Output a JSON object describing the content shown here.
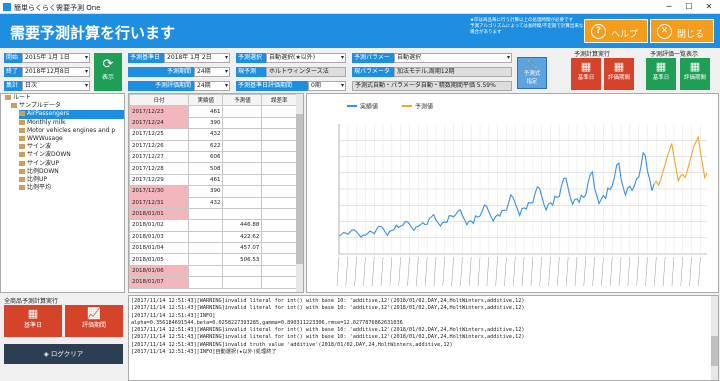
{
  "window": {
    "title": "簡単らくらく需要予測 One"
  },
  "banner": {
    "title": "需要予測計算を行います",
    "note_line1": "★印は商品毎に行う計算以上の処理時間が必要です",
    "note_line2": "予測アルゴリズムによっては長時間/不定期で計算出来ない場合があります",
    "help_label": "ヘルプ",
    "help_icon_glyph": "?",
    "close_label": "閉じる",
    "close_icon_glyph": "✕"
  },
  "params": {
    "start_label": "開始",
    "start_value": "2015年 1月 1日",
    "end_label": "終了",
    "end_value": "2018年12月8日",
    "agg_label": "集計",
    "agg_value": "日次",
    "show_label": "表示",
    "base_date_label": "予測基準日",
    "base_date_value": "2018年 1月 2日",
    "period_label": "予測期間",
    "period_value": "24期",
    "eval_period_label": "予測評価期間",
    "eval_period_value": "24期",
    "select_label": "予測選択",
    "select_value": "自動選択(★以外)",
    "current_label": "現予測",
    "current_value": "ホルトウィンタース法",
    "eval_base_label": "予測基準日評価期間",
    "eval_base_value": "0期",
    "param_label": "予測パラメータ",
    "param_value": "自動選択",
    "current_param_label": "現パラメータ",
    "current_param_value": "加法モデル,周期12期",
    "formula_value": "予測式自動・パラメータ自動・精数期間平価 5.59%",
    "formula_button_line1": "予測式",
    "formula_button_line2": "指定"
  },
  "exec": {
    "title": "予測計算実行",
    "base_btn": "基準日",
    "eval_btn": "評価期間"
  },
  "eval_view": {
    "title": "予測評価一覧表示",
    "base_btn": "基準日",
    "eval_btn": "評価期間"
  },
  "tree": {
    "root": "ルート",
    "group": "サンプルデータ",
    "items": [
      "AirPassengers",
      "Monthly milk",
      "Motor vehicles engines and p",
      "WWWusage",
      "サイン波",
      "サイン波DOWN",
      "サイン波UP",
      "比例DOWN",
      "比例UP",
      "比例平均"
    ]
  },
  "table": {
    "headers": [
      "日付",
      "実績値",
      "予測値",
      "誤差率"
    ],
    "rows": [
      {
        "date": "2017/12/23",
        "actual": "461",
        "forecast": "",
        "err": "",
        "red": true
      },
      {
        "date": "2017/12/24",
        "actual": "390",
        "forecast": "",
        "err": "",
        "red": true
      },
      {
        "date": "2017/12/25",
        "actual": "432",
        "forecast": "",
        "err": "",
        "red": false
      },
      {
        "date": "2017/12/26",
        "actual": "622",
        "forecast": "",
        "err": "",
        "red": false
      },
      {
        "date": "2017/12/27",
        "actual": "606",
        "forecast": "",
        "err": "",
        "red": false
      },
      {
        "date": "2017/12/28",
        "actual": "508",
        "forecast": "",
        "err": "",
        "red": false
      },
      {
        "date": "2017/12/29",
        "actual": "461",
        "forecast": "",
        "err": "",
        "red": false
      },
      {
        "date": "2017/12/30",
        "actual": "390",
        "forecast": "",
        "err": "",
        "red": true
      },
      {
        "date": "2017/12/31",
        "actual": "432",
        "forecast": "",
        "err": "",
        "red": true
      },
      {
        "date": "2018/01/01",
        "actual": "",
        "forecast": "",
        "err": "",
        "red": true
      },
      {
        "date": "2018/01/02",
        "actual": "",
        "forecast": "446.88",
        "err": "",
        "red": false
      },
      {
        "date": "2018/01/03",
        "actual": "",
        "forecast": "422.62",
        "err": "",
        "red": false
      },
      {
        "date": "2018/01/04",
        "actual": "",
        "forecast": "457.07",
        "err": "",
        "red": false
      },
      {
        "date": "2018/01/05",
        "actual": "",
        "forecast": "506.53",
        "err": "",
        "red": false
      },
      {
        "date": "2018/01/06",
        "actual": "",
        "forecast": "",
        "err": "",
        "red": true
      },
      {
        "date": "2018/01/07",
        "actual": "",
        "forecast": "",
        "err": "",
        "red": true
      }
    ]
  },
  "bottom": {
    "title": "全商品予測計算実行",
    "base_btn": "基準日",
    "eval_btn": "評価期間",
    "log_clear": "ログクリア"
  },
  "log": {
    "lines": [
      "[2017/11/14 12:51:43][WARNING]invalid literal for int() with base 10: 'additive,12'(2018/01/02,DAY,24,HoltWinters,additive,12)",
      "[2017/11/14 12:51:43][WARNING]invalid literal for int() with base 10: 'additive,12'(2018/01/02,DAY,24,HoltWinters,additive,12)",
      "[2017/11/14 12:51:43][INFO]",
      "alpha=0.356184691544,beta=0.0258227393285,gamma=0.890311223306,rmse=12.0277876862631036",
      "[2017/11/14 12:51:43][WARNING]invalid literal for int() with base 10: 'additive,12'(2018/01/02,DAY,24,HoltWinters,additive,12)",
      "[2017/11/14 12:51:43][WARNING]invalid literal for int() with base 10: 'additive,12'(2018/01/02,DAY,24,HoltWinters,additive,12)",
      "[2017/11/14 12:51:43][WARNING]invalid truth value 'additive'(2018/01/02,DAY,24,HoltWinters,additive,12)",
      "[2017/11/14 12:51:43][INFO]自動選択(★以外)処理終了"
    ]
  },
  "chart_data": {
    "type": "line",
    "series": [
      {
        "name": "実績値",
        "color": "#3a8ee6",
        "values": [
          112,
          118,
          132,
          129,
          121,
          135,
          148,
          148,
          136,
          119,
          104,
          118,
          115,
          126,
          141,
          135,
          125,
          149,
          170,
          170,
          158,
          133,
          114,
          140,
          145,
          150,
          178,
          163,
          172,
          178,
          199,
          199,
          184,
          162,
          146,
          166,
          171,
          180,
          193,
          181,
          183,
          218,
          230,
          242,
          209,
          191,
          172,
          194,
          196,
          196,
          236,
          235,
          229,
          243,
          264,
          272,
          237,
          211,
          180,
          201,
          204,
          188,
          235,
          227,
          234,
          264,
          302,
          293,
          259,
          229,
          203,
          229,
          242,
          233,
          267,
          269,
          270,
          315,
          364,
          347,
          312,
          274,
          237,
          278,
          284,
          277,
          317,
          313,
          318,
          374,
          413,
          405,
          355,
          306,
          271,
          306,
          315,
          301,
          356,
          348,
          355,
          422,
          465,
          467,
          404,
          347,
          305,
          336,
          340,
          318,
          362,
          348,
          363,
          435,
          491,
          505,
          404,
          359,
          310,
          337,
          360,
          342,
          406,
          396,
          420,
          472,
          548,
          559,
          463,
          407,
          362,
          405,
          417,
          391,
          419,
          461,
          472,
          535,
          622,
          606,
          508,
          461,
          390,
          432
        ]
      },
      {
        "name": "予測値",
        "color": "#f0a530",
        "values": [
          447,
          423,
          457,
          506,
          550,
          600,
          640,
          680,
          600,
          520,
          450,
          480,
          490,
          470,
          510,
          560,
          610,
          660,
          690,
          720,
          630,
          550,
          470,
          500
        ]
      }
    ],
    "y_range": [
      0,
      800
    ],
    "y_ticks": [
      100,
      200,
      300,
      400,
      500,
      600,
      700
    ],
    "legend_position": "top-left",
    "grid": true
  }
}
